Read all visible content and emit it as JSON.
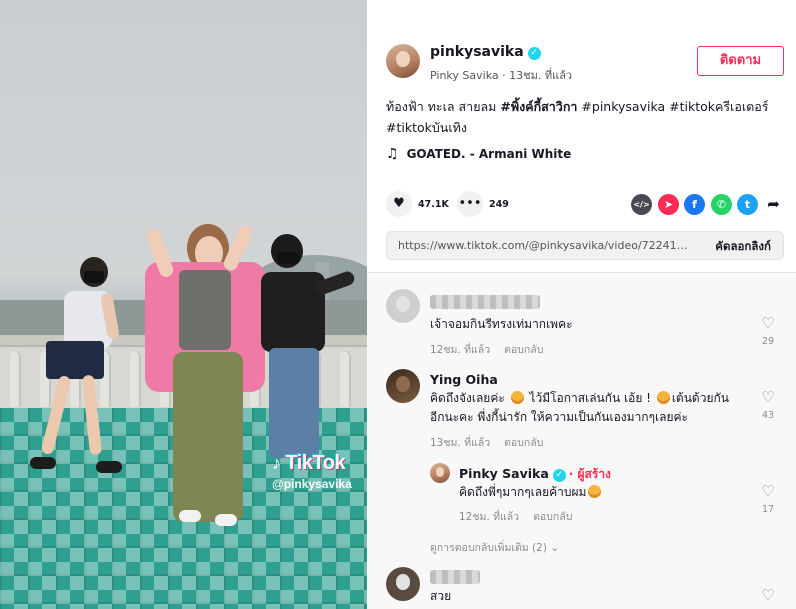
{
  "video": {
    "watermark_logo": "TikTok",
    "watermark_handle": "@pinkysavika"
  },
  "author": {
    "username": "pinkysavika",
    "display_name": "Pinky Savika",
    "time": "13ชม. ที่แล้ว",
    "follow_label": "ติดตาม"
  },
  "description": {
    "text_plain": "ท้องฟ้า ทะเล สายลม ",
    "tags": [
      "#พิ้งค์กี้สาวิกา",
      "#pinkysavika",
      "#tiktokครีเอเตอร์",
      "#tiktokบันเทิง"
    ]
  },
  "music": {
    "note_icon": "music-note-icon",
    "title": "GOATED. - Armani White"
  },
  "actions": {
    "likes": "47.1K",
    "comments": "249"
  },
  "share_icons": [
    {
      "name": "embed-icon",
      "glyph": "</>",
      "color": "#4a4a55"
    },
    {
      "name": "send-to-friends-icon",
      "glyph": "➤",
      "color": "#fe2c55"
    },
    {
      "name": "facebook-icon",
      "glyph": "f",
      "color": "#1877f2"
    },
    {
      "name": "whatsapp-icon",
      "glyph": "✆",
      "color": "#25d366"
    },
    {
      "name": "twitter-icon",
      "glyph": "t",
      "color": "#1da1f2"
    }
  ],
  "link": {
    "url": "https://www.tiktok.com/@pinkysavika/video/7224135967...",
    "copy_label": "คัดลอกลิงก์"
  },
  "comments": [
    {
      "name": "",
      "text": "เจ้าจอมกินรีทรงเท่มากเพคะ",
      "time": "12ชม. ที่แล้ว",
      "reply_label": "ตอบกลับ",
      "likes": "29"
    },
    {
      "name": "Ying Oiha",
      "text_1": "คิดถึงจังเลยค่ะ ",
      "text_2": " ไว้มีโอกาสเล่นกัน เอ้ย ! ",
      "text_3": "เต้นด้วยกัน",
      "text_line2": "อีกนะคะ พี่งกี้น่ารัก ให้ความเป็นกันเองมากๆเลยค่ะ",
      "time": "13ชม. ที่แล้ว",
      "reply_label": "ตอบกลับ",
      "likes": "43"
    },
    {
      "name": "Pinky Savika",
      "creator_tag": "· ผู้สร้าง",
      "text": "คิดถึงพี่ๆมากๆเลยค้าบผม",
      "time": "12ชม. ที่แล้ว",
      "reply_label": "ตอบกลับ",
      "likes": "17"
    },
    {
      "name": "",
      "text": "สวย",
      "likes": ""
    }
  ],
  "view_more": "ดูการตอบกลับเพิ่มเติม (2) ⌄"
}
